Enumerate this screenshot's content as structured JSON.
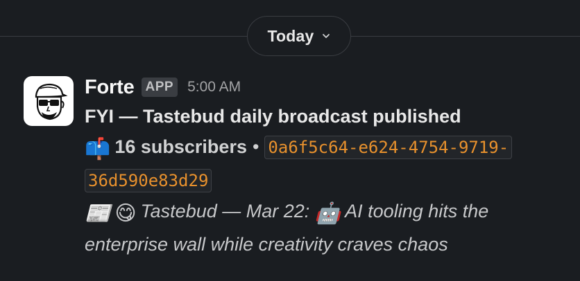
{
  "divider": {
    "date_label": "Today",
    "chevron_icon": "chevron-down-icon"
  },
  "message": {
    "avatar_icon": "robot-avatar-icon",
    "sender": "Forte",
    "badge": "APP",
    "timestamp": "5:00 AM",
    "title": "FYI — Tastebud daily broadcast published",
    "stats": {
      "mailbox_emoji": "📫",
      "subscribers_text": "16 subscribers",
      "bullet": "•",
      "id_code": "0a6f5c64-e624-4754-9719-36d590e83d29"
    },
    "headline": {
      "newspaper_emoji": "📰",
      "yum_emoji": "😋",
      "prefix": "Tastebud — Mar 22:",
      "robot_emoji": "🤖",
      "text": "AI tooling hits the enterprise wall while creativity craves chaos"
    }
  }
}
